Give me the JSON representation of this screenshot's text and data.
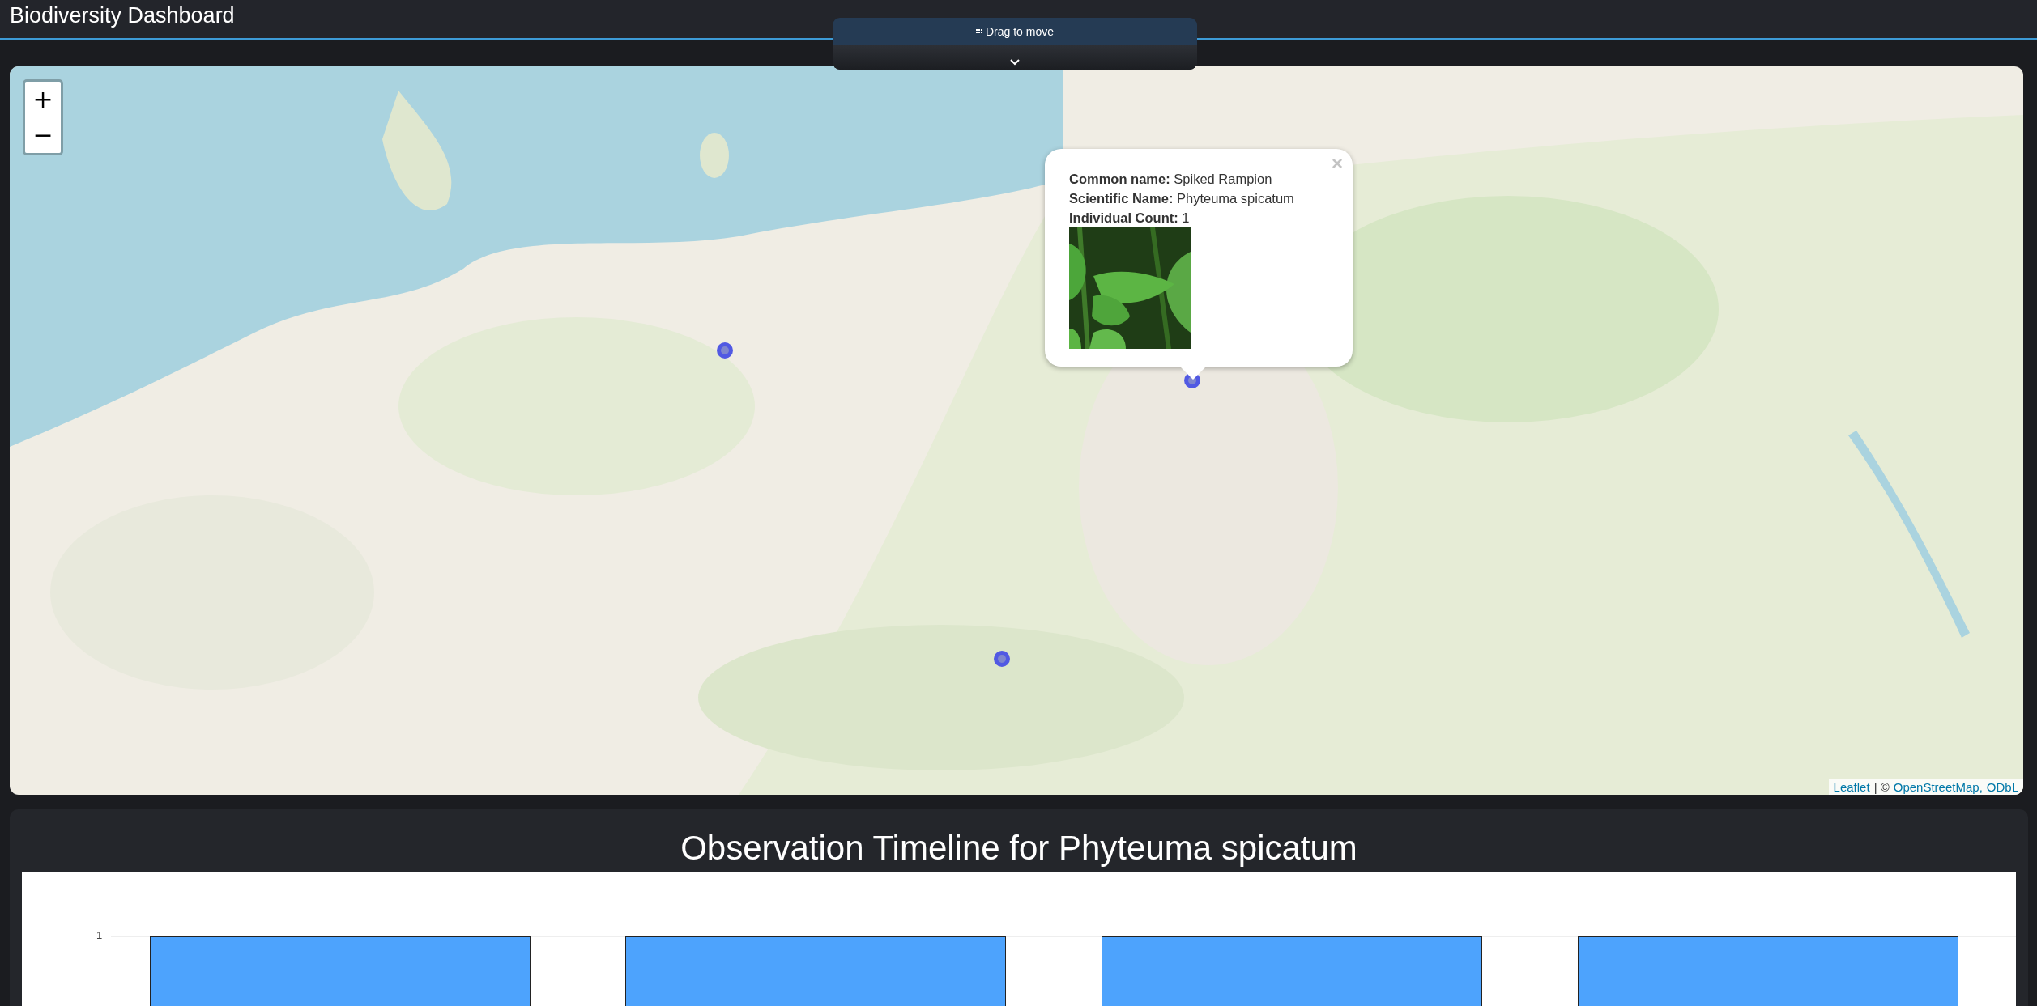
{
  "header": {
    "title": "Biodiversity Dashboard"
  },
  "drag_handle": {
    "label": "Drag to move"
  },
  "map": {
    "zoom_in": "+",
    "zoom_out": "−",
    "popup": {
      "close": "×",
      "fields": [
        {
          "label": "Common name:",
          "value": "Spiked Rampion"
        },
        {
          "label": "Scientific Name:",
          "value": "Phyteuma spicatum"
        },
        {
          "label": "Individual Count:",
          "value": "1"
        }
      ]
    },
    "attribution": [
      {
        "kind": "link",
        "text": "Leaflet"
      },
      {
        "kind": "text",
        "text": "| ©"
      },
      {
        "kind": "link",
        "text": "OpenStreetMap,"
      },
      {
        "kind": "link",
        "text": "ODbL"
      }
    ]
  },
  "timeline": {
    "title": "Observation Timeline for Phyteuma spicatum",
    "y_tick": "1"
  }
}
